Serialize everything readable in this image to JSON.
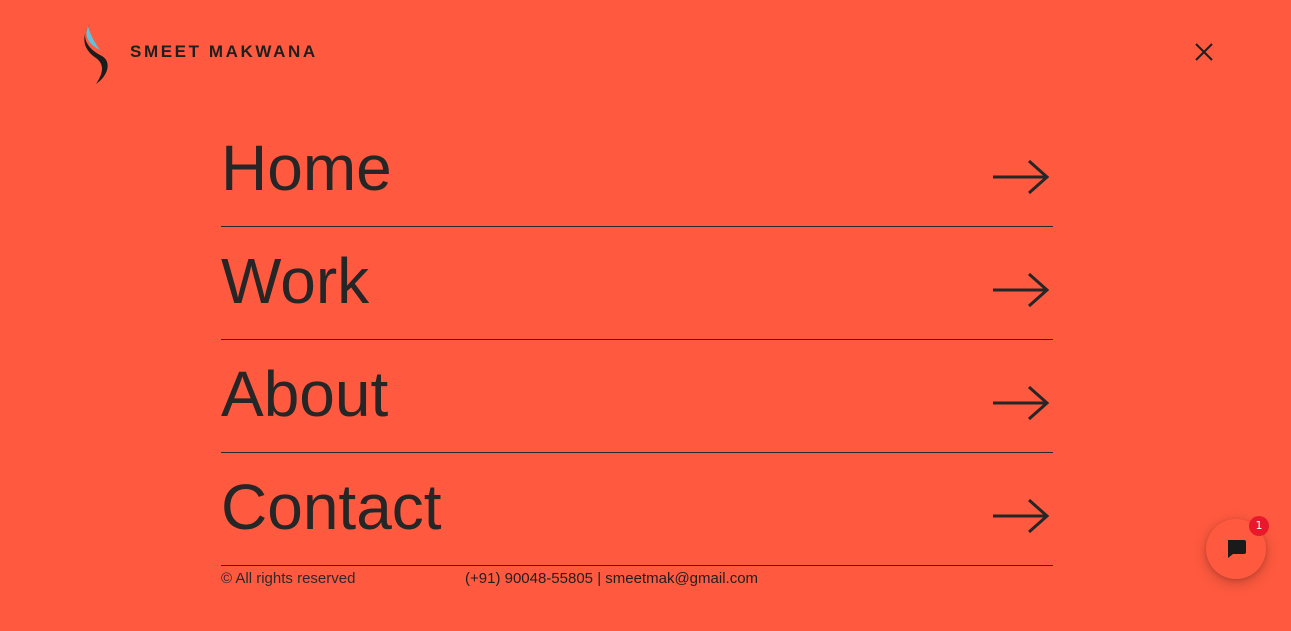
{
  "brand": {
    "name": "SMEET MAKWANA",
    "logo_icon": "swoosh-logo-icon",
    "colors": {
      "background": "#ff5a3f",
      "text": "#262626",
      "logo_accent": "#5bc4e0"
    }
  },
  "header": {
    "close_icon": "close-icon"
  },
  "nav": {
    "items": [
      {
        "label": "Home",
        "icon": "arrow-right-icon"
      },
      {
        "label": "Work",
        "icon": "arrow-right-icon"
      },
      {
        "label": "About",
        "icon": "arrow-right-icon"
      },
      {
        "label": "Contact",
        "icon": "arrow-right-icon"
      }
    ]
  },
  "footer": {
    "copyright": "© All rights reserved",
    "phone": "(+91) 90048-55805",
    "separator": " | ",
    "email": "smeetmak@gmail.com"
  },
  "chat": {
    "icon": "chat-bubble-icon",
    "badge_count": "1",
    "badge_color": "#e8192c"
  }
}
